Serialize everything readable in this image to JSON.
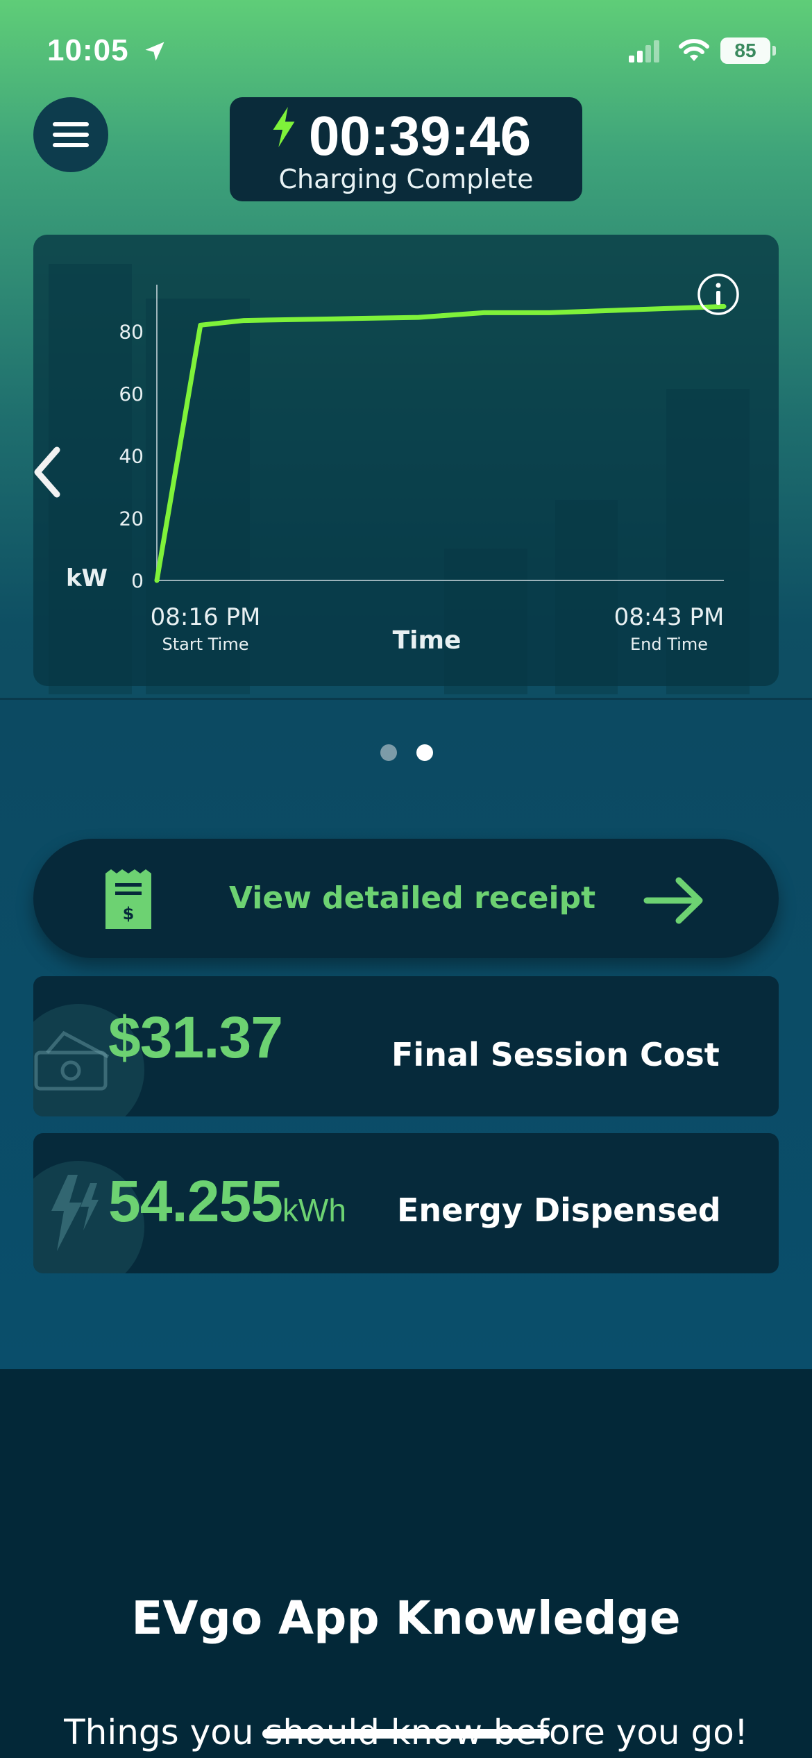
{
  "status_bar": {
    "time": "10:05",
    "battery": "85"
  },
  "session": {
    "timer": "00:39:46",
    "status": "Charging Complete"
  },
  "chart_data": {
    "type": "line",
    "y_unit_label": "kW",
    "xlabel": "Time",
    "ylim": [
      0,
      95
    ],
    "y_ticks": [
      0,
      20,
      40,
      60,
      80
    ],
    "x_start_label": "08:16 PM",
    "x_start_caption": "Start Time",
    "x_end_label": "08:43 PM",
    "x_end_caption": "End Time",
    "x": [
      0,
      2,
      4,
      8,
      12,
      15,
      18,
      22,
      26
    ],
    "values": [
      0,
      82,
      83.5,
      84,
      84.5,
      86,
      86,
      87,
      88
    ],
    "series_color": "#7ff23a"
  },
  "carousel": {
    "active_index": 1,
    "count": 2
  },
  "receipt": {
    "label": "View detailed receipt"
  },
  "cost": {
    "value": "$31.37",
    "label": "Final Session Cost"
  },
  "energy": {
    "value": "54.255",
    "unit": "kWh",
    "label": "Energy Dispensed"
  },
  "knowledge": {
    "title": "EVgo App Knowledge",
    "subtitle": "Things you should know before you go!"
  },
  "colors": {
    "accent": "#6dd272",
    "card": "#062a3b",
    "hero_top": "#5fcd78"
  },
  "icons": [
    "location-arrow-icon",
    "signal-icon",
    "wifi-icon",
    "menu-icon",
    "bolt-icon",
    "info-icon",
    "chevron-left-icon",
    "receipt-icon",
    "arrow-right-icon",
    "cash-icon",
    "zap-icon"
  ]
}
